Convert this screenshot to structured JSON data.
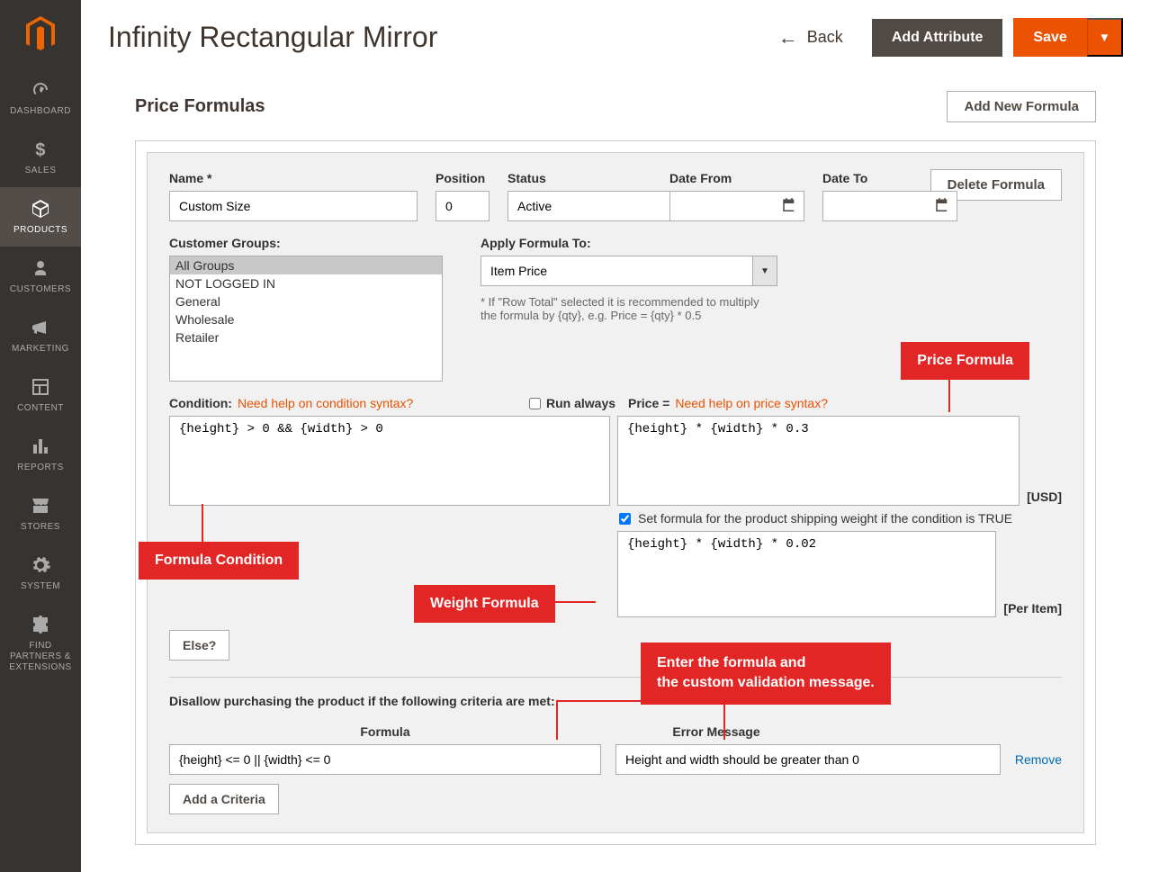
{
  "page_title": "Infinity Rectangular Mirror",
  "back_label": "Back",
  "add_attribute_label": "Add Attribute",
  "save_label": "Save",
  "section_title": "Price Formulas",
  "add_formula_label": "Add New Formula",
  "delete_formula_label": "Delete Formula",
  "nav": {
    "dashboard": "DASHBOARD",
    "sales": "SALES",
    "products": "PRODUCTS",
    "customers": "CUSTOMERS",
    "marketing": "MARKETING",
    "content": "CONTENT",
    "reports": "REPORTS",
    "stores": "STORES",
    "system": "SYSTEM",
    "partners": "FIND PARTNERS & EXTENSIONS"
  },
  "fields": {
    "name_label": "Name *",
    "name_value": "Custom Size",
    "position_label": "Position",
    "position_value": "0",
    "status_label": "Status",
    "status_value": "Active",
    "date_from_label": "Date From",
    "date_from_value": "",
    "date_to_label": "Date To",
    "date_to_value": "",
    "customer_groups_label": "Customer Groups:",
    "customer_groups": [
      "All Groups",
      "NOT LOGGED IN",
      "General",
      "Wholesale",
      "Retailer"
    ],
    "apply_to_label": "Apply Formula To:",
    "apply_to_value": "Item Price",
    "apply_to_hint": "* If \"Row Total\" selected it is recommended to multiply the formula by {qty}, e.g. Price = {qty} * 0.5",
    "condition_label": "Condition:",
    "condition_help": "Need help on condition syntax?",
    "run_always_label": "Run always",
    "price_label": "Price =",
    "price_help": "Need help on price syntax?",
    "condition_value": "{height} > 0 && {width} > 0",
    "price_value": "{height} * {width} * 0.3",
    "usd": "[USD]",
    "weight_checkbox": "Set formula for the product shipping weight if the condition is TRUE",
    "weight_value": "{height} * {width} * 0.02",
    "per_item": "[Per Item]",
    "else_label": "Else?",
    "criteria_header": "Disallow purchasing the product if the following criteria are met:",
    "formula_col": "Formula",
    "error_col": "Error Message",
    "criteria_formula": "{height} <= 0 || {width} <= 0",
    "criteria_error": "Height and width should be greater than 0",
    "remove_label": "Remove",
    "add_criteria_label": "Add a Criteria"
  },
  "callouts": {
    "price_formula": "Price Formula",
    "formula_condition": "Formula Condition",
    "weight_formula": "Weight Formula",
    "enter_formula_l1": "Enter the formula and",
    "enter_formula_l2": "the custom validation message."
  }
}
